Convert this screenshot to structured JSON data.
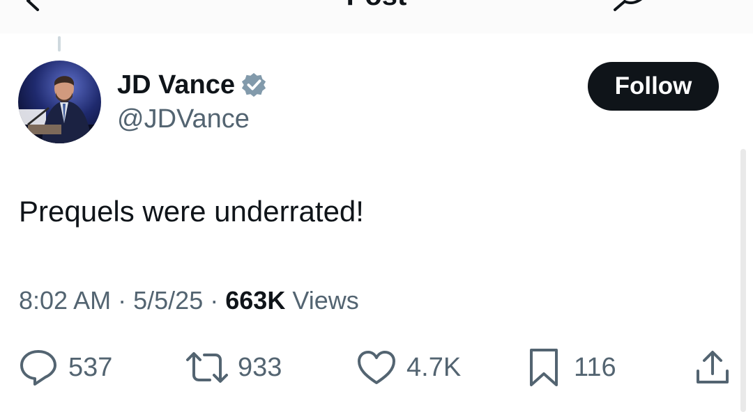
{
  "header": {
    "title": "Post"
  },
  "author": {
    "name": "JD Vance",
    "handle": "@JDVance",
    "verified": true,
    "follow_label": "Follow"
  },
  "post": {
    "text": "Prequels were underrated!",
    "time": "8:02 AM",
    "date": "5/5/25",
    "separator": "·",
    "views_count": "663K",
    "views_label": "Views"
  },
  "actions": {
    "replies": "537",
    "reposts": "933",
    "likes": "4.7K",
    "bookmarks": "116"
  },
  "icons": {
    "back": "arrow-left-icon",
    "reply": "reply-icon",
    "verified": "verified-badge-icon",
    "repost": "repost-icon",
    "like": "heart-icon",
    "bookmark": "bookmark-icon",
    "share": "share-icon"
  },
  "colors": {
    "text_primary": "#0f1419",
    "text_secondary": "#536471",
    "follow_bg": "#0f1419",
    "verified_badge": "#829aab"
  }
}
